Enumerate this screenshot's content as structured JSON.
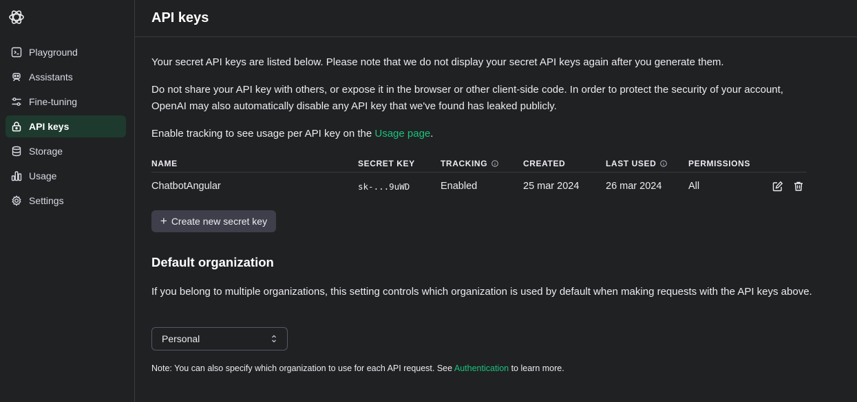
{
  "sidebar": {
    "items": [
      {
        "label": "Playground",
        "icon": "terminal-icon",
        "active": false
      },
      {
        "label": "Assistants",
        "icon": "robot-icon",
        "active": false
      },
      {
        "label": "Fine-tuning",
        "icon": "sliders-icon",
        "active": false
      },
      {
        "label": "API keys",
        "icon": "lock-icon",
        "active": true
      },
      {
        "label": "Storage",
        "icon": "database-icon",
        "active": false
      },
      {
        "label": "Usage",
        "icon": "chart-icon",
        "active": false
      },
      {
        "label": "Settings",
        "icon": "gear-icon",
        "active": false
      }
    ]
  },
  "header": {
    "title": "API keys"
  },
  "intro": {
    "p1": "Your secret API keys are listed below. Please note that we do not display your secret API keys again after you generate them.",
    "p2": "Do not share your API key with others, or expose it in the browser or other client-side code. In order to protect the security of your account, OpenAI may also automatically disable any API key that we've found has leaked publicly.",
    "p3_before": "Enable tracking to see usage per API key on the ",
    "p3_link": "Usage page",
    "p3_after": "."
  },
  "table": {
    "headers": {
      "name": "NAME",
      "secret_key": "SECRET KEY",
      "tracking": "TRACKING",
      "created": "CREATED",
      "last_used": "LAST USED",
      "permissions": "PERMISSIONS"
    },
    "rows": [
      {
        "name": "ChatbotAngular",
        "secret_key": "sk-...9uWD",
        "tracking": "Enabled",
        "created": "25 mar 2024",
        "last_used": "26 mar 2024",
        "permissions": "All"
      }
    ]
  },
  "create_button": {
    "label": "Create new secret key"
  },
  "default_org": {
    "title": "Default organization",
    "description": "If you belong to multiple organizations, this setting controls which organization is used by default when making requests with the API keys above.",
    "selected": "Personal",
    "note_before": "Note: You can also specify which organization to use for each API request. See ",
    "note_link": "Authentication",
    "note_after": " to learn more."
  },
  "colors": {
    "accent": "#19c37d",
    "background": "#202123",
    "active_nav": "#1e3a2e"
  }
}
